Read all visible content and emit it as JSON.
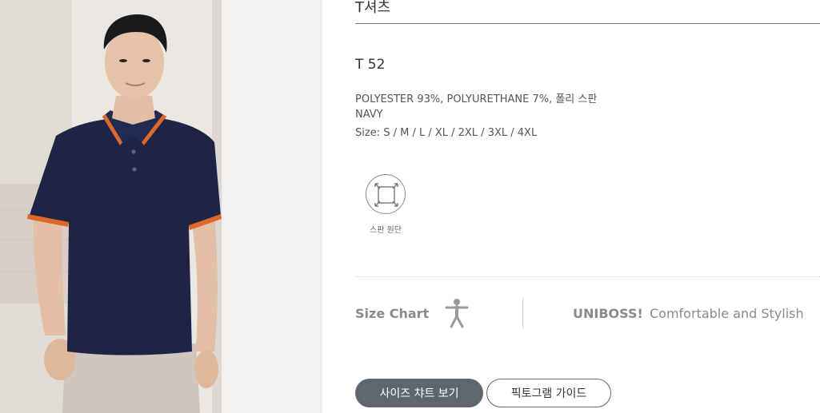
{
  "product": {
    "category": "T셔츠",
    "model": "T 52",
    "material": "POLYESTER 93%, POLYURETHANE 7%, 폴리 스판",
    "color": "NAVY",
    "sizes": "Size: S / M / L / XL / 2XL / 3XL / 4XL",
    "photo_colors": {
      "shirt": "#1d2447",
      "tipping": "#e0672a",
      "pants": "#cfc6bd"
    }
  },
  "feature": {
    "icon": "stretch-fabric-icon",
    "label": "스판 원단"
  },
  "size_chart": {
    "label": "Size Chart",
    "icon": "person-icon"
  },
  "brand": {
    "name": "UNIBOSS!",
    "slogan": "Comfortable and Stylish"
  },
  "buttons": {
    "size_chart_view": "사이즈 챠트 보기",
    "pictogram_guide": "픽토그램 가이드"
  },
  "colors": {
    "primary_button": "#5e6670",
    "muted_text": "#8a8a8a"
  }
}
